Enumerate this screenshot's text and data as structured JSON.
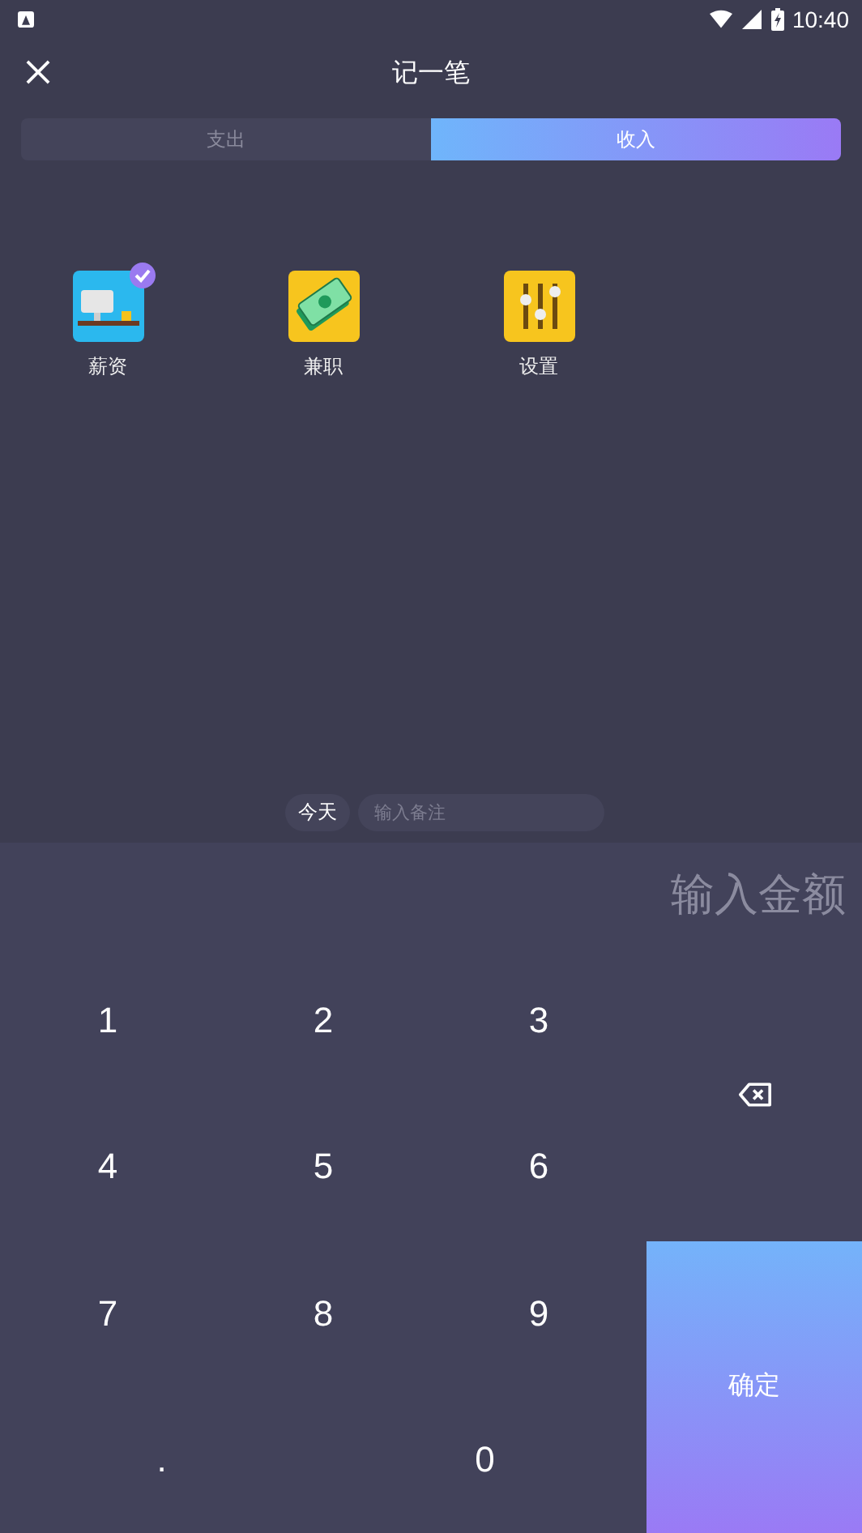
{
  "status_bar": {
    "time": "10:40"
  },
  "header": {
    "title": "记一笔"
  },
  "tabs": [
    {
      "label": "支出",
      "selected": false
    },
    {
      "label": "收入",
      "selected": true
    }
  ],
  "categories": [
    {
      "label": "薪资",
      "kind": "desk",
      "selected": true
    },
    {
      "label": "兼职",
      "kind": "money",
      "selected": false
    },
    {
      "label": "设置",
      "kind": "sliders",
      "selected": false
    }
  ],
  "note_bar": {
    "date": "今天",
    "placeholder": "输入备注"
  },
  "amount": {
    "placeholder": "输入金额"
  },
  "keys": [
    "1",
    "2",
    "3",
    "4",
    "5",
    "6",
    "7",
    "8",
    "9"
  ],
  "bottom_keys": [
    ".",
    "0"
  ],
  "confirm": "确定"
}
